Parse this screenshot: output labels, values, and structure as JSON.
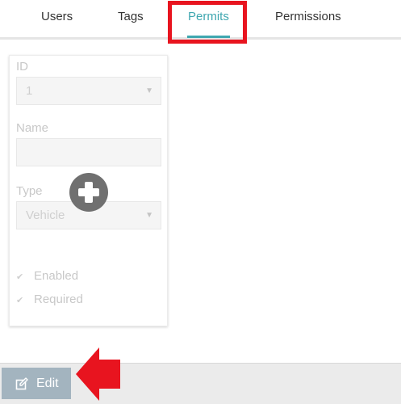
{
  "tabs": [
    {
      "label": "Users",
      "active": false
    },
    {
      "label": "Tags",
      "active": false
    },
    {
      "label": "Permits",
      "active": true
    },
    {
      "label": "Permissions",
      "active": false
    }
  ],
  "form": {
    "id_label": "ID",
    "id_value": "1",
    "name_label": "Name",
    "name_value": "",
    "type_label": "Type",
    "type_value": "Vehicle",
    "enabled_label": "Enabled",
    "enabled_checked": true,
    "required_label": "Required",
    "required_checked": true
  },
  "actions": {
    "add_icon": "plus-circle-icon",
    "edit_label": "Edit",
    "edit_icon": "edit-icon"
  },
  "annotations": {
    "highlight_color": "#e8141f",
    "arrow_color": "#e8141f"
  },
  "colors": {
    "accent": "#3fa7b0",
    "edit_button": "#a3b4bf"
  }
}
